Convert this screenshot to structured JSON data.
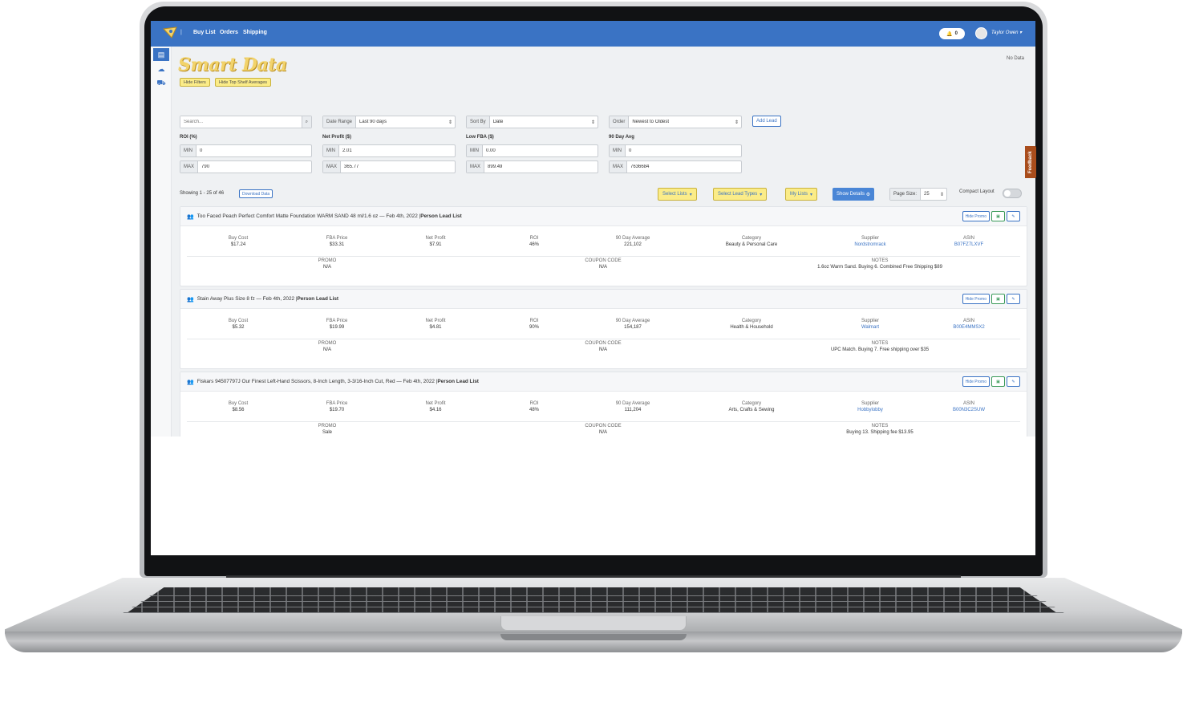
{
  "nav": {
    "links": [
      "Buy List",
      "Orders",
      "Shipping"
    ],
    "notifications": "0",
    "user": "Taylor Owen"
  },
  "page": {
    "title": "Smart Data",
    "no_data": "No Data",
    "hide_filters": "Hide Filters",
    "hide_top_shelf": "Hide Top Shelf Averages"
  },
  "filters": {
    "search_placeholder": "Search...",
    "date_range_label": "Date Range",
    "date_range_value": "Last 90 days",
    "sort_by_label": "Sort By",
    "sort_by_value": "Date",
    "order_label": "Order",
    "order_value": "Newest to Oldest",
    "add_lead": "Add Lead",
    "roi_label": "ROI (%)",
    "net_profit_label": "Net Profit ($)",
    "low_fba_label": "Low FBA ($)",
    "avg90_label": "90 Day Avg",
    "min": "MIN",
    "max": "MAX",
    "roi_min": "0",
    "roi_max": "790",
    "np_min": "2.01",
    "np_max": "365.77",
    "fba_min": "0.00",
    "fba_max": "899.49",
    "avg_min": "0",
    "avg_max": "7636684"
  },
  "toolbar": {
    "showing": "Showing 1 - 25 of 46",
    "download": "Download Data",
    "select_lists": "Select Lists",
    "select_lead_types": "Select Lead Types",
    "my_lists": "My Lists",
    "show_details": "Show Details",
    "page_size_label": "Page Size:",
    "page_size_value": "25",
    "compact_layout": "Compact Layout",
    "feedback": "Feedback"
  },
  "labels": {
    "buy_cost": "Buy Cost",
    "fba_price": "FBA Price",
    "net_profit": "Net Profit",
    "roi": "ROI",
    "avg90": "90 Day Average",
    "category": "Category",
    "supplier": "Supplier",
    "asin": "ASIN",
    "promo": "PROMO",
    "coupon": "COUPON CODE",
    "notes": "NOTES",
    "hide_promo": "Hide Promo"
  },
  "leads": [
    {
      "title": "Too Faced Peach Perfect Comfort Matte Foundation WARM SAND 48 ml/1.6 oz — Feb 4th, 2022 | ",
      "list": "Person Lead List",
      "buy_cost": "$17.24",
      "fba_price": "$33.31",
      "net_profit": "$7.91",
      "roi": "46%",
      "avg90": "221,102",
      "category": "Beauty & Personal Care",
      "supplier": "Nordstromrack",
      "asin": "B07FZ7LXVF",
      "promo": "N/A",
      "coupon": "N/A",
      "notes": "1.6oz Warm Sand. Buying 6. Combined Free Shipping $89"
    },
    {
      "title": "Stain Away Plus Size 8 fz — Feb 4th, 2022 | ",
      "list": "Person Lead List",
      "buy_cost": "$5.32",
      "fba_price": "$19.99",
      "net_profit": "$4.81",
      "roi": "90%",
      "avg90": "154,187",
      "category": "Health & Household",
      "supplier": "Walmart",
      "asin": "B00E4MMSX2",
      "promo": "N/A",
      "coupon": "N/A",
      "notes": "UPC Match. Buying 7. Free shipping over $35"
    },
    {
      "title": "Fiskars 94507797J Our Finest Left-Hand Scissors, 8-Inch Length, 3-3/16-Inch Cut, Red — Feb 4th, 2022 | ",
      "list": "Person Lead List",
      "buy_cost": "$8.56",
      "fba_price": "$19.70",
      "net_profit": "$4.16",
      "roi": "48%",
      "avg90": "111,204",
      "category": "Arts, Crafts & Sewing",
      "supplier": "Hobbylobby",
      "asin": "B00N3C2SUW",
      "promo": "Sale",
      "coupon": "N/A",
      "notes": "Buying 13. Shipping fee $13.95"
    }
  ]
}
